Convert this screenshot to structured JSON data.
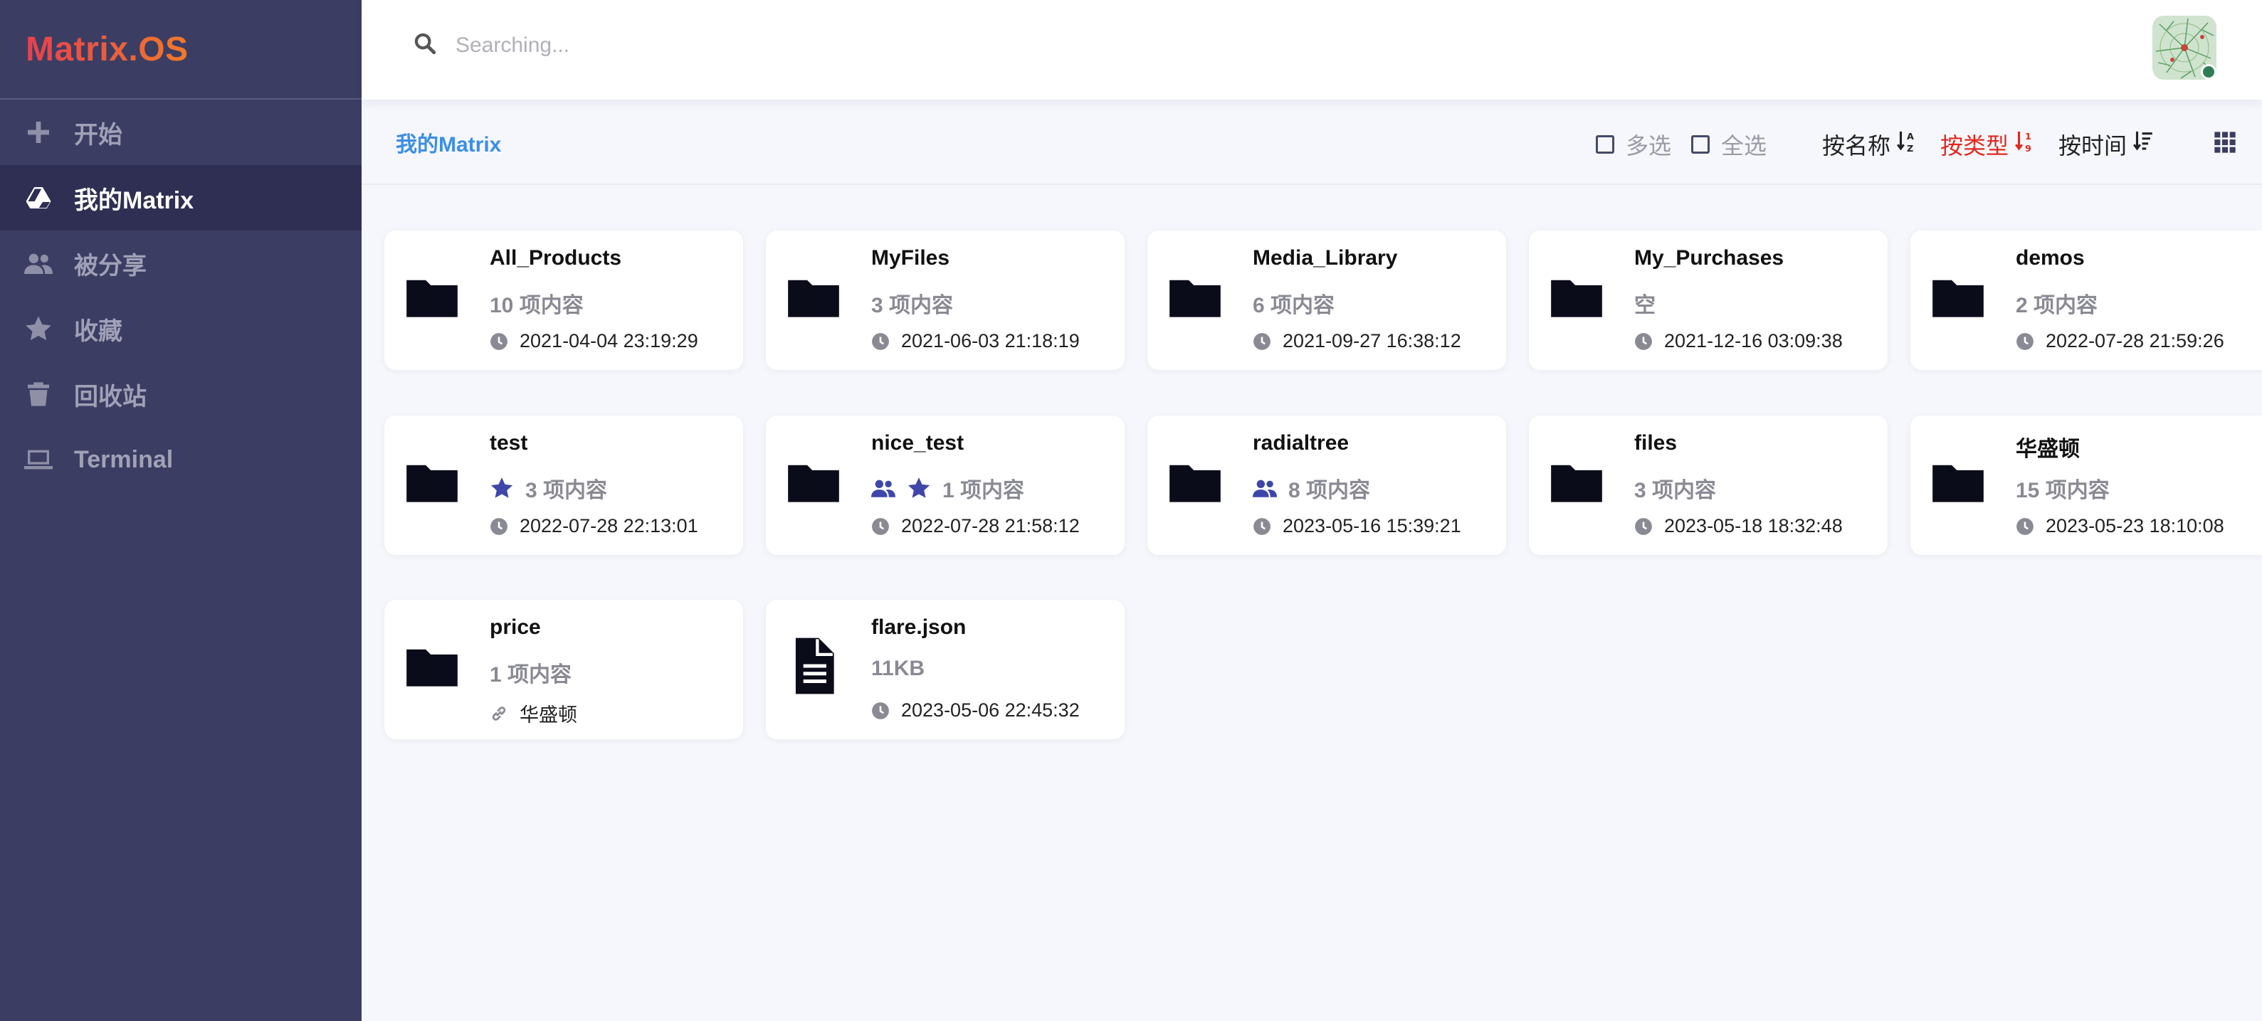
{
  "brand": "Matrix.OS",
  "sidebar": {
    "items": [
      {
        "label": "开始",
        "icon": "plus-icon"
      },
      {
        "label": "我的Matrix",
        "icon": "drive-icon"
      },
      {
        "label": "被分享",
        "icon": "users-icon"
      },
      {
        "label": "收藏",
        "icon": "star-icon"
      },
      {
        "label": "回收站",
        "icon": "trash-icon"
      },
      {
        "label": "Terminal",
        "icon": "laptop-icon"
      }
    ]
  },
  "search": {
    "placeholder": "Searching..."
  },
  "toolbar": {
    "breadcrumb": "我的Matrix",
    "multi_select": "多选",
    "select_all": "全选",
    "sort_name": "按名称",
    "sort_type": "按类型",
    "sort_time": "按时间",
    "sort_type_color": "#e0281f"
  },
  "files": [
    {
      "name": "All_Products",
      "meta": "10 项内容",
      "time": "2021-04-04 23:19:29"
    },
    {
      "name": "MyFiles",
      "meta": "3 项内容",
      "time": "2021-06-03 21:18:19"
    },
    {
      "name": "Media_Library",
      "meta": "6 项内容",
      "time": "2021-09-27 16:38:12"
    },
    {
      "name": "My_Purchases",
      "meta": "空",
      "time": "2021-12-16 03:09:38"
    },
    {
      "name": "demos",
      "meta": "2 项内容",
      "time": "2022-07-28 21:59:26"
    },
    {
      "name": "test",
      "meta": "3 项内容",
      "time": "2022-07-28 22:13:01"
    },
    {
      "name": "nice_test",
      "meta": "1 项内容",
      "time": "2022-07-28 21:58:12"
    },
    {
      "name": "radialtree",
      "meta": "8 项内容",
      "time": "2023-05-16 15:39:21"
    },
    {
      "name": "files",
      "meta": "3 项内容",
      "time": "2023-05-18 18:32:48"
    },
    {
      "name": "华盛顿",
      "meta": "15 项内容",
      "time": "2023-05-23 18:10:08"
    },
    {
      "name": "price",
      "meta": "1 项内容",
      "link": "华盛顿"
    },
    {
      "name": "flare.json",
      "meta": "11KB",
      "time": "2023-05-06 22:45:32"
    }
  ],
  "colors": {
    "sidebar": "#3c3d63",
    "accent": "#3c8ee8",
    "badge_icons": "#3e47a8"
  }
}
